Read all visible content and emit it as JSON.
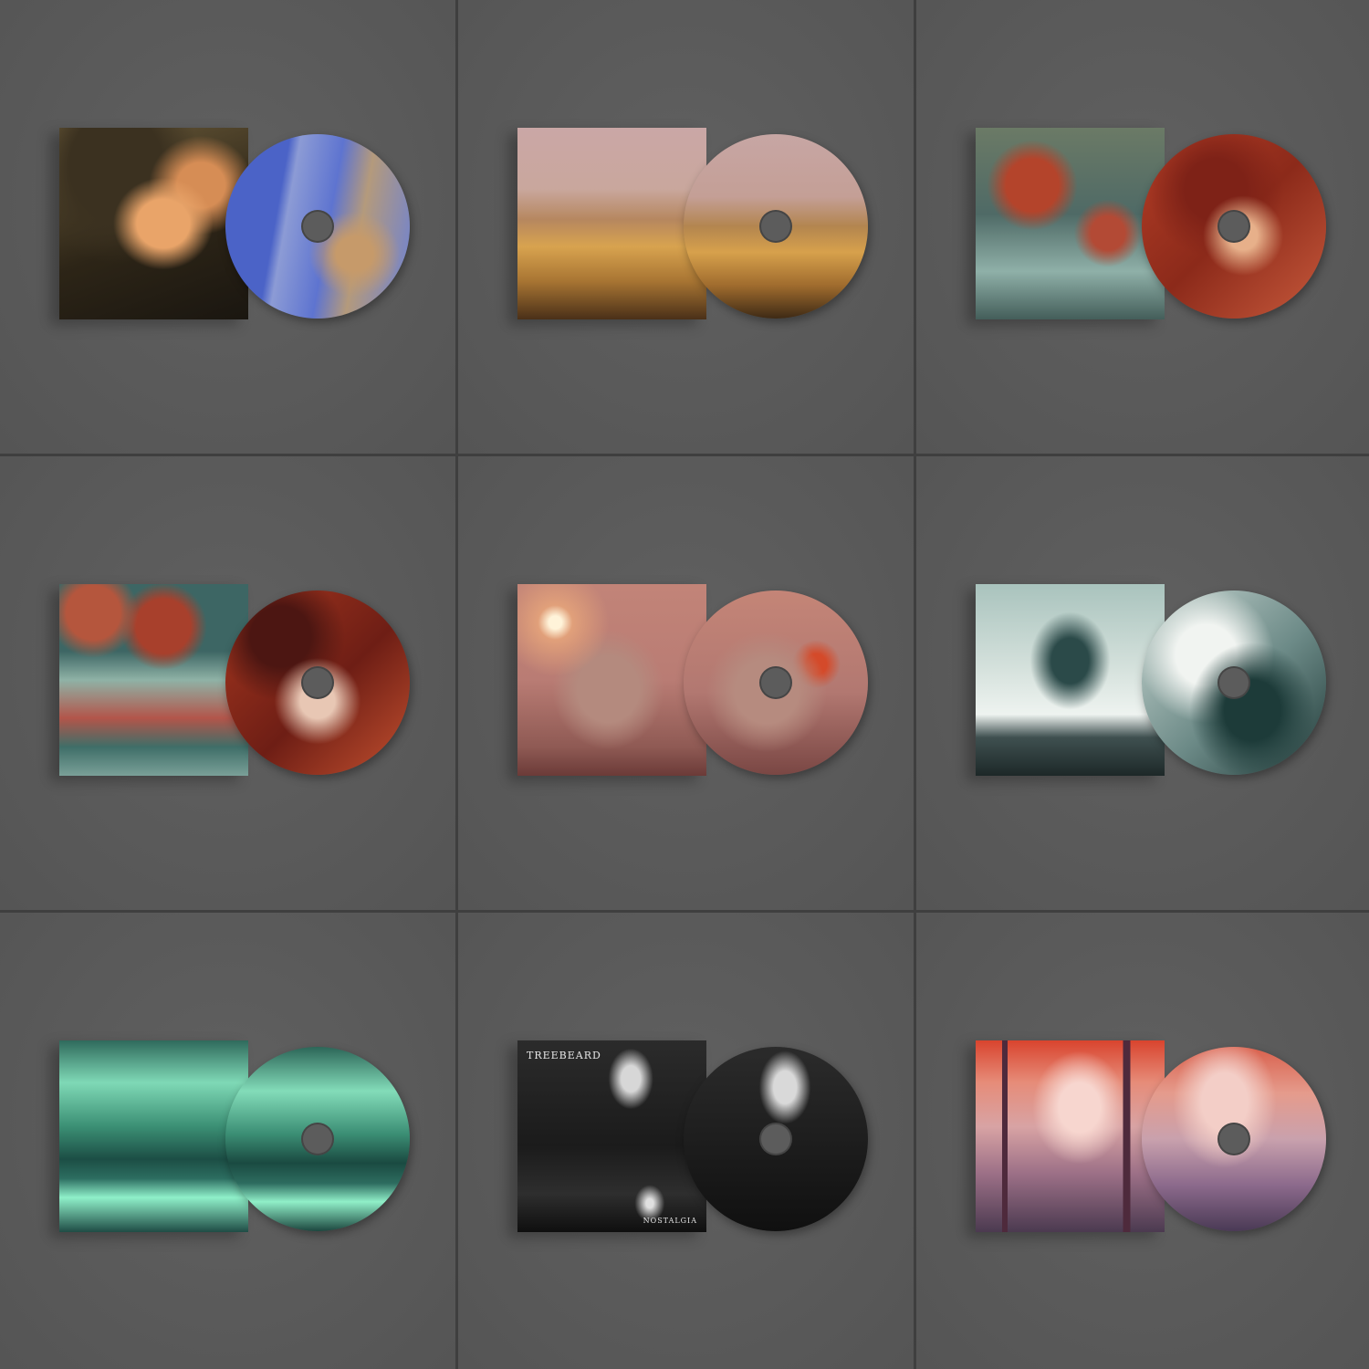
{
  "colors": {
    "background": "#5a5a5a",
    "divider": "#3f3f3f"
  },
  "mockups": [
    {
      "position": 1,
      "artwork": "abstract-faces",
      "text": {
        "title": "",
        "subtitle": ""
      }
    },
    {
      "position": 2,
      "artwork": "figure-in-field",
      "text": {
        "title": "",
        "subtitle": ""
      }
    },
    {
      "position": 3,
      "artwork": "pixelated-planet",
      "text": {
        "title": "",
        "subtitle": ""
      }
    },
    {
      "position": 4,
      "artwork": "planets-over-mountains",
      "text": {
        "title": "",
        "subtitle": ""
      }
    },
    {
      "position": 5,
      "artwork": "stone-figure-sunset",
      "text": {
        "title": "",
        "subtitle": ""
      }
    },
    {
      "position": 6,
      "artwork": "stormy-sea",
      "text": {
        "title": "",
        "subtitle": ""
      }
    },
    {
      "position": 7,
      "artwork": "green-mountain-lake",
      "text": {
        "title": "",
        "subtitle": ""
      }
    },
    {
      "position": 8,
      "artwork": "jellyfish-landscape",
      "text": {
        "title": "TREEBEARD",
        "subtitle": "NOSTALGIA"
      }
    },
    {
      "position": 9,
      "artwork": "cathedral-statue",
      "text": {
        "title": "",
        "subtitle": ""
      }
    }
  ]
}
